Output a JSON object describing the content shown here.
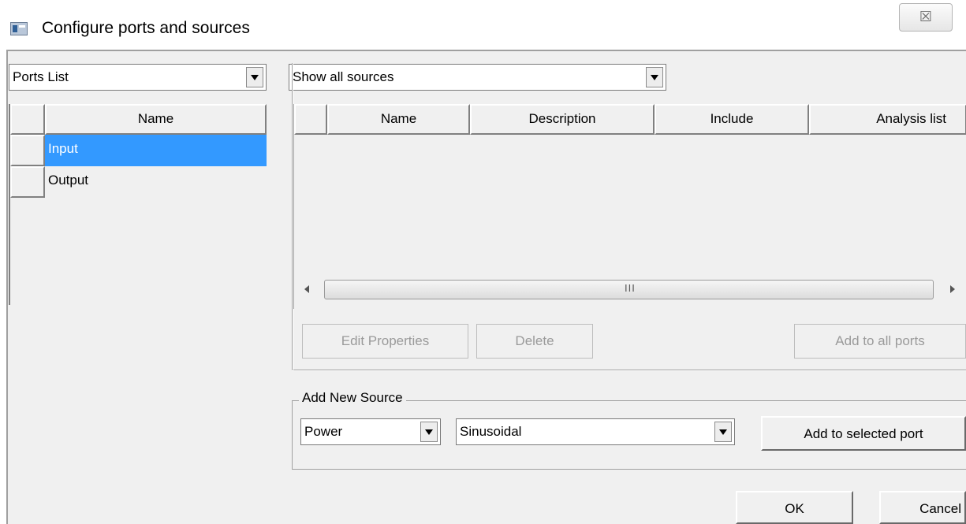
{
  "window": {
    "title": "Configure ports and sources",
    "close_glyph": "☒"
  },
  "ports": {
    "list_selector": "Ports List",
    "columns": [
      "Name"
    ],
    "rows": [
      {
        "name": "Input",
        "selected": true
      },
      {
        "name": "Output",
        "selected": false
      }
    ]
  },
  "sources": {
    "filter": "Show all sources",
    "columns": [
      "Name",
      "Description",
      "Include",
      "Analysis list"
    ],
    "rows": [],
    "scroll_grip": "III"
  },
  "actions": {
    "edit_properties": "Edit Properties",
    "delete": "Delete",
    "add_to_all_ports": "Add to all ports"
  },
  "add_new_source": {
    "group_label": "Add New Source",
    "type": "Power",
    "waveform": "Sinusoidal",
    "add_button": "Add to selected port"
  },
  "dialog_buttons": {
    "ok": "OK",
    "cancel": "Cancel"
  },
  "colors": {
    "selection": "#3399ff",
    "dialog_background": "#f0f0f0"
  },
  "icons": {
    "app": "app-window-icon",
    "close": "close-icon",
    "dropdown": "chevron-down-icon"
  }
}
